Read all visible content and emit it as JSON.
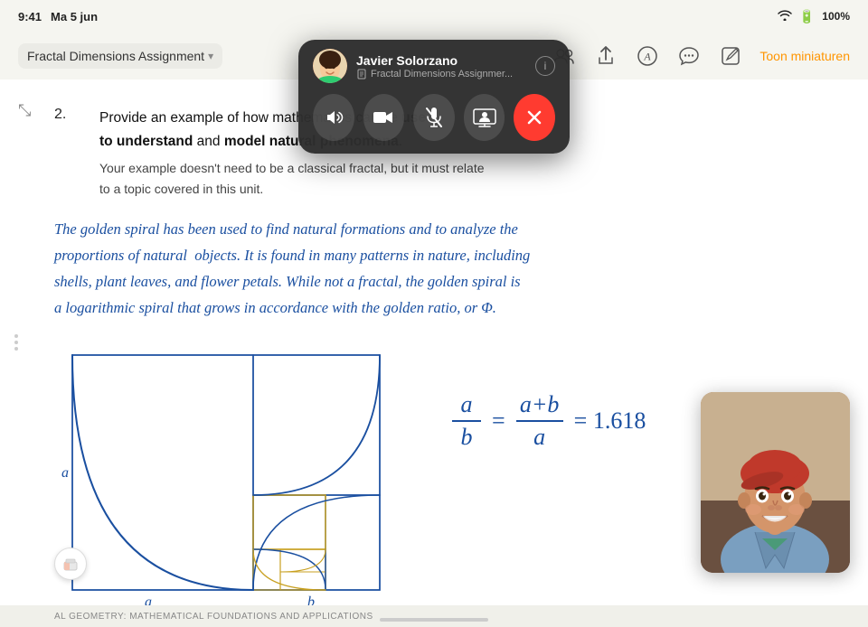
{
  "statusBar": {
    "time": "9:41",
    "day": "Ma 5 jun",
    "battery": "100%",
    "wifi": "WiFi"
  },
  "toolbar": {
    "docTitle": "Fractal Dimensions Assignment",
    "chevron": "▾",
    "toonLabel": "Toon miniaturen",
    "collapseIcon": "⤡",
    "icons": {
      "people": "👥",
      "share": "⬆",
      "pencil": "✏",
      "bubble": "···",
      "edit": "✎"
    }
  },
  "content": {
    "questionNum": "2.",
    "questionMain": "Provide an example of how mathematics can be ",
    "questionBold1": "used to understand",
    "questionMid": " and ",
    "questionBold2": "model natural phenomena",
    "questionEnd": ".",
    "subtext": "Your example doesn't need to be a classical fractal, but it must relate\nto a topic covered in this unit.",
    "handwritten": "The golden spiral has been used to find natural formations and to analyze the proportions of natural objects. It is found in many patterns in nature, including shells, plant leaves, and flower petals. While not a fractal, the golden spiral is a logarithmic spiral that grows in accordance with the golden ratio, or Φ.",
    "formula": "a/b = (a+b)/a = 1.618",
    "labelA": "a",
    "labelA2": "a",
    "labelB": "b"
  },
  "bottomBar": {
    "text": "AL GEOMETRY: MATHEMATICAL FOUNDATIONS AND APPLICATIONS"
  },
  "facetime": {
    "name": "Javier Solorzano",
    "subtitle": "Fractal Dimensions Assignmer...",
    "infoBtn": "i",
    "buttons": {
      "speaker": "🔊",
      "video": "📷",
      "mute": "🎤",
      "screen": "⬜",
      "end": "✕"
    }
  }
}
